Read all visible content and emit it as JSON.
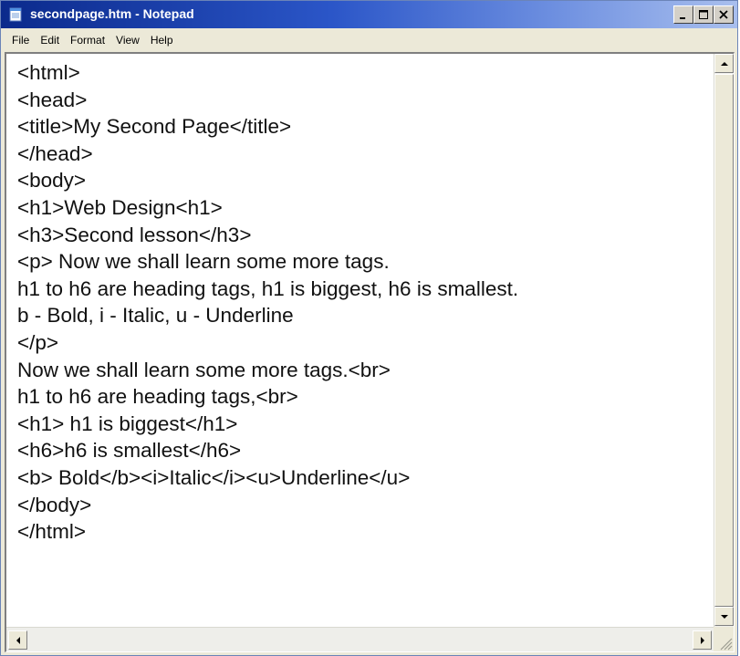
{
  "window": {
    "title": "secondpage.htm - Notepad",
    "icon": "notepad-icon"
  },
  "caption_buttons": {
    "minimize_icon": "minimize-icon",
    "maximize_icon": "maximize-icon",
    "close_icon": "close-icon"
  },
  "menu": {
    "items": [
      "File",
      "Edit",
      "Format",
      "View",
      "Help"
    ]
  },
  "editor": {
    "lines": [
      "<html>",
      "<head>",
      "<title>My Second Page</title>",
      "</head>",
      "<body>",
      "<h1>Web Design<h1>",
      "<h3>Second lesson</h3>",
      "<p> Now we shall learn some more tags.",
      "h1 to h6 are heading tags, h1 is biggest, h6 is smallest.",
      "b - Bold, i - Italic, u - Underline",
      "</p>",
      "Now we shall learn some more tags.<br>",
      "h1 to h6 are heading tags,<br>",
      "<h1> h1 is biggest</h1>",
      "<h6>h6 is smallest</h6>",
      "<b> Bold</b><i>Italic</i><u>Underline</u>",
      "</body>",
      "</html>"
    ]
  },
  "colors": {
    "titlebar_start": "#0b2a8c",
    "titlebar_end": "#a9bfee",
    "chrome": "#ece9d8",
    "text": "#111111"
  }
}
